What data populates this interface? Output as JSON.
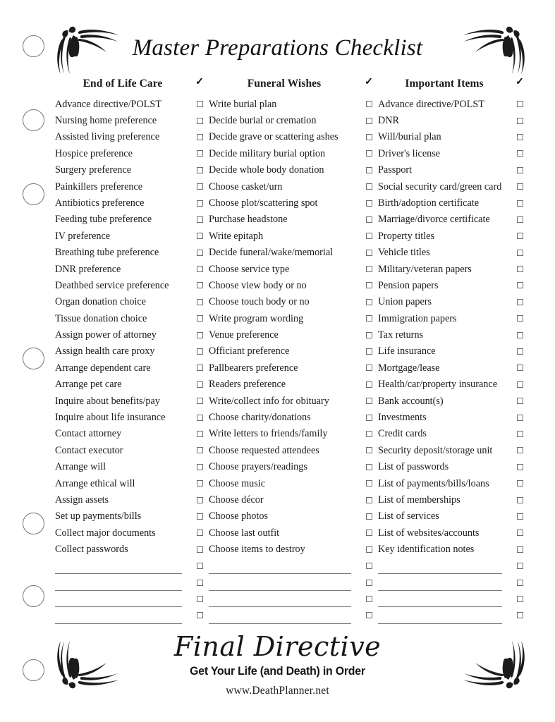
{
  "document": {
    "title": "Master Preparations Checklist",
    "check_symbol": "✓"
  },
  "columns": [
    {
      "header": "End of Life Care",
      "items": [
        "Advance directive/POLST",
        "Nursing home preference",
        "Assisted living preference",
        "Hospice preference",
        "Surgery preference",
        "Painkillers preference",
        "Antibiotics preference",
        "Feeding tube preference",
        "IV preference",
        "Breathing tube preference",
        "DNR preference",
        "Deathbed service preference",
        "Organ donation choice",
        "Tissue donation choice",
        "Assign power of attorney",
        "Assign health care proxy",
        "Arrange dependent care",
        "Arrange pet care",
        "Inquire about benefits/pay",
        "Inquire about life insurance",
        "Contact attorney",
        "Contact executor",
        "Arrange will",
        "Arrange ethical will",
        "Assign assets",
        "Set up payments/bills",
        "Collect major documents",
        "Collect passwords"
      ],
      "blank_lines": 4
    },
    {
      "header": "Funeral Wishes",
      "items": [
        "Write burial plan",
        "Decide burial or cremation",
        "Decide grave or scattering ashes",
        "Decide military burial option",
        "Decide whole body donation",
        "Choose casket/urn",
        "Choose plot/scattering spot",
        "Purchase headstone",
        "Write epitaph",
        "Decide funeral/wake/memorial",
        "Choose service type",
        "Choose view body or no",
        "Choose touch body or no",
        "Write program wording",
        "Venue preference",
        "Officiant preference",
        "Pallbearers preference",
        "Readers preference",
        "Write/collect info for obituary",
        "Choose charity/donations",
        "Write letters to friends/family",
        "Choose requested attendees",
        "Choose prayers/readings",
        "Choose music",
        "Choose décor",
        "Choose photos",
        "Choose last outfit",
        "Choose items to destroy"
      ],
      "blank_lines": 4
    },
    {
      "header": "Important Items",
      "items": [
        "Advance directive/POLST",
        "DNR",
        "Will/burial plan",
        "Driver's license",
        "Passport",
        "Social security card/green card",
        "Birth/adoption certificate",
        "Marriage/divorce certificate",
        "Property titles",
        "Vehicle titles",
        "Military/veteran papers",
        "Pension papers",
        "Union papers",
        "Immigration papers",
        "Tax returns",
        "Life insurance",
        "Mortgage/lease",
        "Health/car/property insurance",
        "Bank account(s)",
        "Investments",
        "Credit cards",
        "Security deposit/storage unit",
        "List of passwords",
        "List of payments/bills/loans",
        "List of memberships",
        "List of services",
        "List of websites/accounts",
        "Key identification notes"
      ],
      "blank_lines": 4
    }
  ],
  "footer": {
    "brand": "Final Directive",
    "tagline": "Get Your Life (and Death) in Order",
    "website": "www.DeathPlanner.net"
  },
  "binder_holes": [
    65,
    170,
    275,
    508,
    742,
    845,
    950
  ]
}
